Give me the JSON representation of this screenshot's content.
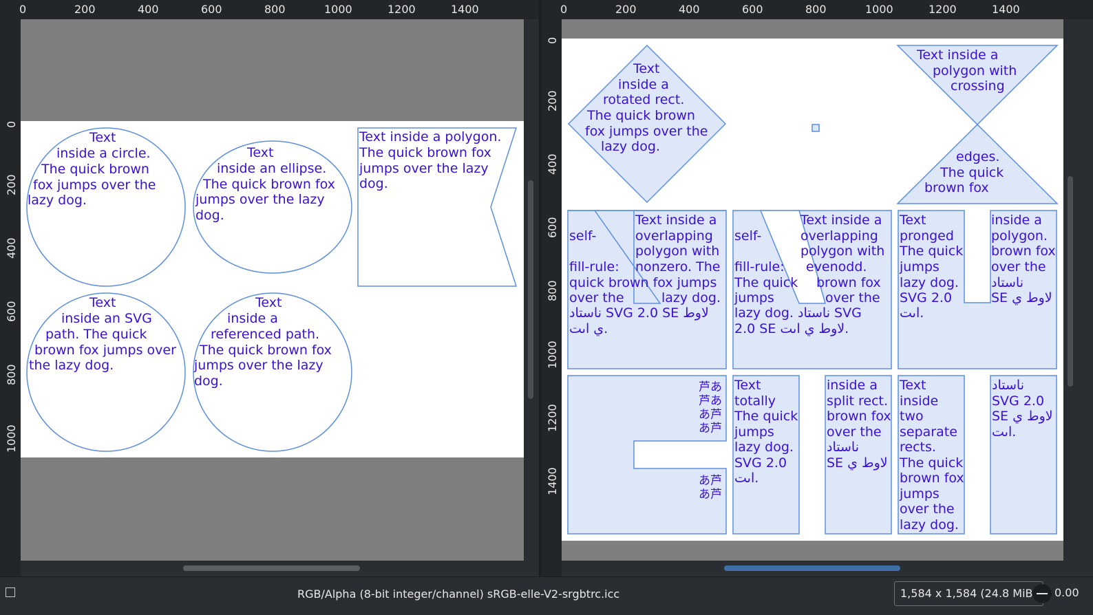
{
  "left_view": {
    "ruler_labels": [
      "0",
      "200",
      "400",
      "600",
      "800",
      "1000",
      "1200",
      "1400"
    ],
    "ruler_v_labels": [
      "0",
      "200",
      "400",
      "600",
      "800",
      "1000"
    ],
    "shapes": {
      "circle": [
        "Text",
        "inside a circle.",
        "The quick brown",
        "fox jumps over the",
        "lazy dog."
      ],
      "ellipse": [
        "Text",
        "inside an ellipse.",
        "The quick brown fox",
        "jumps over the lazy",
        "dog."
      ],
      "polygon": [
        "Text inside a polygon.",
        "The quick brown fox",
        "jumps over the lazy",
        "dog."
      ],
      "svg_path": [
        "Text",
        "inside an SVG",
        "path. The quick",
        "brown fox jumps over",
        "the lazy dog."
      ],
      "referenced_path": [
        "Text",
        "inside a",
        "referenced path.",
        "The quick brown fox",
        "jumps over the lazy",
        "dog."
      ]
    }
  },
  "right_view": {
    "ruler_labels": [
      "0",
      "200",
      "400",
      "600",
      "800",
      "1000",
      "1200",
      "1400"
    ],
    "ruler_v_labels": [
      "0",
      "200",
      "400",
      "600",
      "800",
      "1000",
      "1200",
      "1400"
    ],
    "shapes": {
      "rotated_rect": [
        "Text",
        "inside a",
        "rotated rect.",
        "The quick brown",
        "fox jumps over the",
        "lazy dog."
      ],
      "crossing_top": [
        "Text inside a",
        "polygon with",
        "crossing"
      ],
      "crossing_bottom": [
        "edges.",
        "The quick",
        "brown fox"
      ],
      "nonzero_left": [
        "self-",
        "",
        "fill-rule:",
        "quick brown fox jumps",
        "over the",
        "ناستاد SVG 2.0 SE لاوط",
        "ي اىت."
      ],
      "nonzero_right": [
        "Text inside a",
        "overlapping",
        "polygon with",
        "nonzero. The",
        "",
        "lazy dog."
      ],
      "evenodd_left": [
        "self-",
        "",
        "fill-rule:",
        "The quick",
        "jumps",
        "lazy dog. ناستاد SVG",
        "2.0 SE لاوط ي اىت."
      ],
      "evenodd_right": [
        "Text inside a",
        "overlapping",
        "polygon with",
        "evenodd.",
        "brown fox",
        "over the"
      ],
      "pronged_left": [
        "Text",
        "pronged",
        "The quick",
        "jumps",
        "lazy dog.",
        "SVG 2.0",
        "اىت."
      ],
      "pronged_right": [
        "inside a",
        "polygon.",
        "brown fox",
        "over the",
        "ناستاد",
        "SE لاوط ي"
      ],
      "vertical_cjk": [
        "芦あ",
        "芦あ",
        "あ芦",
        "あ芦",
        "あ芦",
        "あ芦"
      ],
      "split_left": [
        "Text",
        "totally",
        "The quick",
        "jumps",
        "lazy dog.",
        "SVG 2.0",
        "اىت."
      ],
      "split_right": [
        "inside a",
        "split rect.",
        "brown fox",
        "over the",
        "ناستاد",
        "SE لاوط ي"
      ],
      "separate_left": [
        "Text",
        "inside",
        "two",
        "separate",
        "rects.",
        "The quick",
        "brown fox",
        "jumps",
        "over the",
        "lazy dog."
      ],
      "separate_right": [
        "ناستاد",
        "SVG 2.0",
        "SE لاوط ي",
        "اىت."
      ]
    }
  },
  "statusbar": {
    "color_info": "RGB/Alpha (8-bit integer/channel)  sRGB-elle-V2-srgbtrc.icc",
    "image_size": "1,584 x 1,584 (24.8 MiB)",
    "zoom": "0.00"
  },
  "colors": {
    "text": "#3a10d8",
    "stroke": "#5b8fe0",
    "fill": "#dde7f8",
    "canvas": "#7f7f7f"
  }
}
